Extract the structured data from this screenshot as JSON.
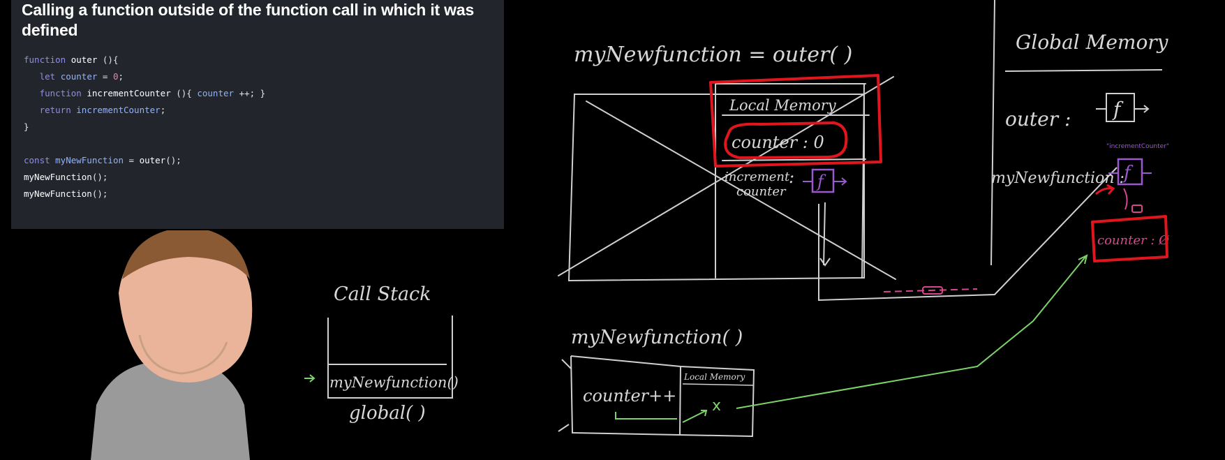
{
  "slide": {
    "title": "Calling a function outside of the function call in which it was defined",
    "code_lines": [
      [
        {
          "t": "kw",
          "s": "function "
        },
        {
          "t": "nm",
          "s": "outer "
        },
        {
          "t": "pu",
          "s": "(){"
        }
      ],
      [
        {
          "t": "pu",
          "s": "   "
        },
        {
          "t": "kw",
          "s": "let "
        },
        {
          "t": "vr",
          "s": "counter "
        },
        {
          "t": "pu",
          "s": "= "
        },
        {
          "t": "num",
          "s": "0"
        },
        {
          "t": "pu",
          "s": ";"
        }
      ],
      [
        {
          "t": "pu",
          "s": "   "
        },
        {
          "t": "kw",
          "s": "function "
        },
        {
          "t": "nm",
          "s": "incrementCounter "
        },
        {
          "t": "pu",
          "s": "(){ "
        },
        {
          "t": "vr",
          "s": "counter "
        },
        {
          "t": "pu",
          "s": "++; }"
        }
      ],
      [
        {
          "t": "pu",
          "s": "   "
        },
        {
          "t": "kw",
          "s": "return "
        },
        {
          "t": "vr",
          "s": "incrementCounter"
        },
        {
          "t": "pu",
          "s": ";"
        }
      ],
      [
        {
          "t": "pu",
          "s": "}"
        }
      ],
      [
        {
          "t": "pu",
          "s": ""
        }
      ],
      [
        {
          "t": "kw",
          "s": "const "
        },
        {
          "t": "vr",
          "s": "myNewFunction "
        },
        {
          "t": "pu",
          "s": "= "
        },
        {
          "t": "nm",
          "s": "outer"
        },
        {
          "t": "pu",
          "s": "();"
        }
      ],
      [
        {
          "t": "nm",
          "s": "myNewFunction"
        },
        {
          "t": "pu",
          "s": "();"
        }
      ],
      [
        {
          "t": "nm",
          "s": "myNewFunction"
        },
        {
          "t": "pu",
          "s": "();"
        }
      ]
    ]
  },
  "board": {
    "assignment": "myNewfunction  =  outer( )",
    "local_memory_label": "Local Memory",
    "local_counter": "counter : 0",
    "increment_label_1": "increment",
    "increment_label_2": "counter",
    "f_glyph": "f",
    "colon": ":",
    "call_stack_title": "Call Stack",
    "call_stack_frame": "myNewfunction()",
    "call_stack_global": "global( )",
    "call_label": "myNewfunction( )",
    "exec_code": "counter++",
    "exec_local_memory": "Local Memory",
    "exec_x": "x",
    "global_memory_title": "Global Memory",
    "global_outer": "outer  :",
    "global_my_new_function": "myNewfunction :",
    "global_small_label": "\"incrementCounter\"",
    "backpack_counter": "counter : Ø",
    "colors": {
      "red": "#e0161f",
      "purple": "#9b59d0",
      "green": "#7cd36a",
      "pink": "#d9468f",
      "chalk": "#d8d8d8"
    }
  }
}
